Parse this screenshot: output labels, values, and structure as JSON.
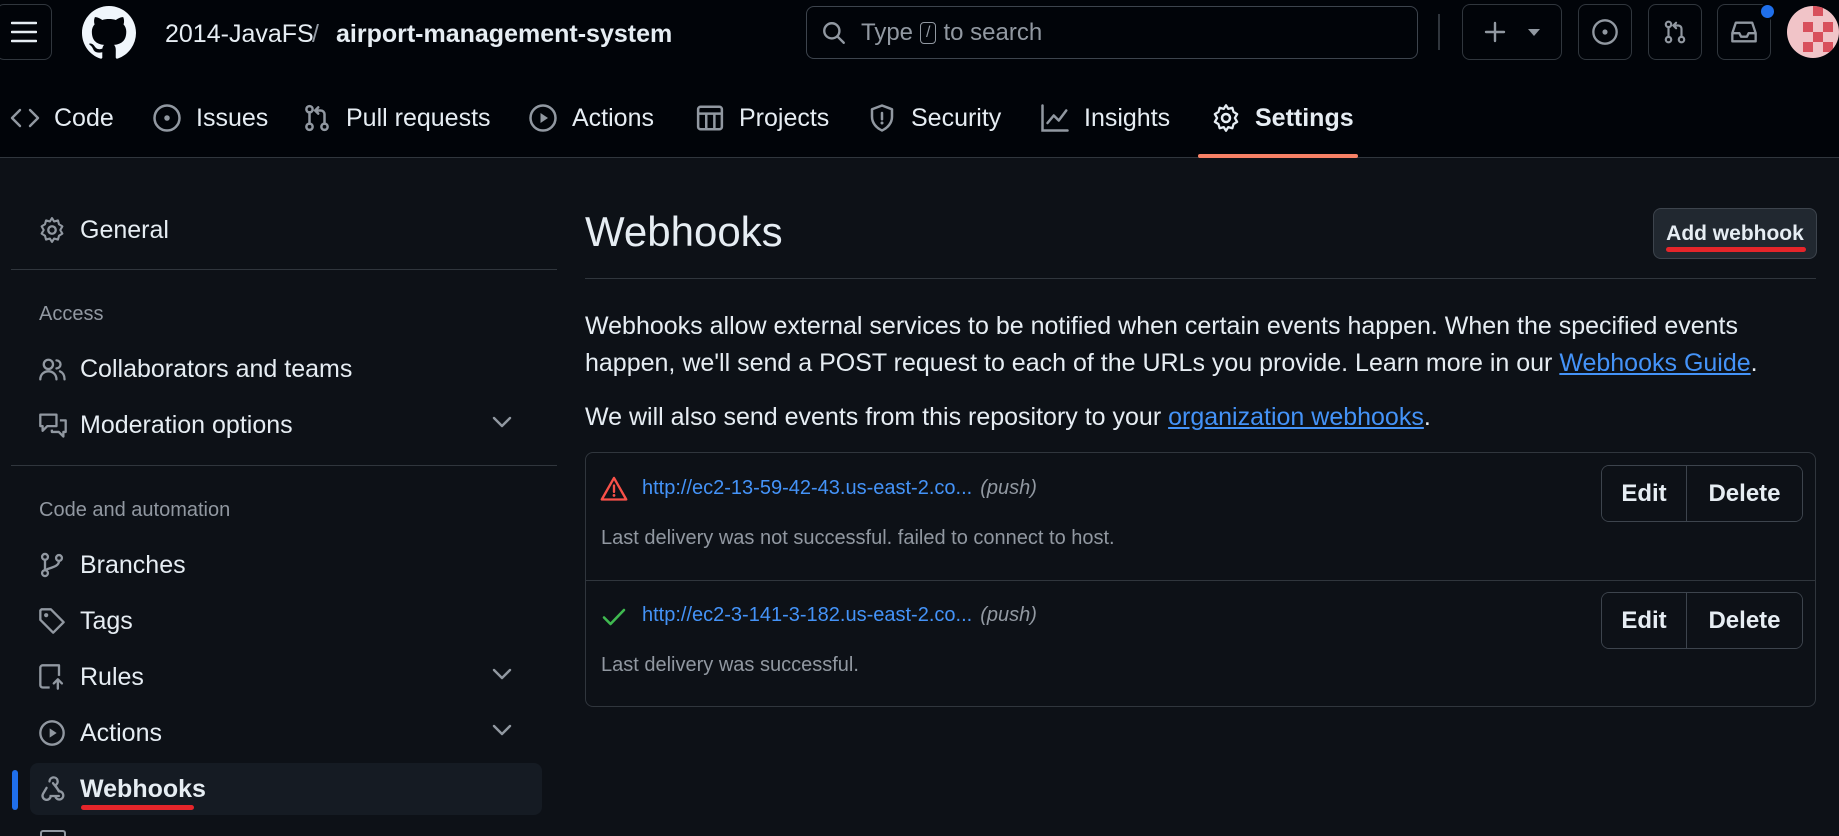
{
  "header": {
    "owner": "2014-JavaFS",
    "separator": "/",
    "repo": "airport-management-system",
    "search": {
      "prefix": "Type",
      "key": "/",
      "suffix": "to search"
    }
  },
  "tabs": [
    {
      "label": "Code",
      "icon": "code-icon"
    },
    {
      "label": "Issues",
      "icon": "issue-icon"
    },
    {
      "label": "Pull requests",
      "icon": "pull-request-icon"
    },
    {
      "label": "Actions",
      "icon": "play-icon"
    },
    {
      "label": "Projects",
      "icon": "table-icon"
    },
    {
      "label": "Security",
      "icon": "shield-icon"
    },
    {
      "label": "Insights",
      "icon": "graph-icon"
    },
    {
      "label": "Settings",
      "icon": "gear-icon",
      "selected": true
    }
  ],
  "sidebar": {
    "general": "General",
    "access_heading": "Access",
    "collaborators": "Collaborators and teams",
    "moderation": "Moderation options",
    "code_heading": "Code and automation",
    "branches": "Branches",
    "tags": "Tags",
    "rules": "Rules",
    "actions": "Actions",
    "webhooks": "Webhooks"
  },
  "main": {
    "title": "Webhooks",
    "add_button": "Add webhook",
    "intro": "Webhooks allow external services to be notified when certain events happen. When the specified events happen, we'll send a POST request to each of the URLs you provide. Learn more in our ",
    "guide_link": "Webhooks Guide",
    "intro_end": ".",
    "org_text": "We will also send events from this repository to your ",
    "org_link": "organization webhooks",
    "org_end": "."
  },
  "webhooks": [
    {
      "url": "http://ec2-13-59-42-43.us-east-2.co...",
      "event": "(push)",
      "message": "Last delivery was not successful. failed to connect to host.",
      "status": "failed",
      "status_color": "#f85149",
      "edit": "Edit",
      "delete": "Delete"
    },
    {
      "url": "http://ec2-3-141-3-182.us-east-2.co...",
      "event": "(push)",
      "message": "Last delivery was successful.",
      "status": "success",
      "status_color": "#3fb950",
      "edit": "Edit",
      "delete": "Delete"
    }
  ],
  "colors": {
    "accent": "#4493f8",
    "annotation": "#e5252a",
    "tab_underline": "#f78166"
  }
}
